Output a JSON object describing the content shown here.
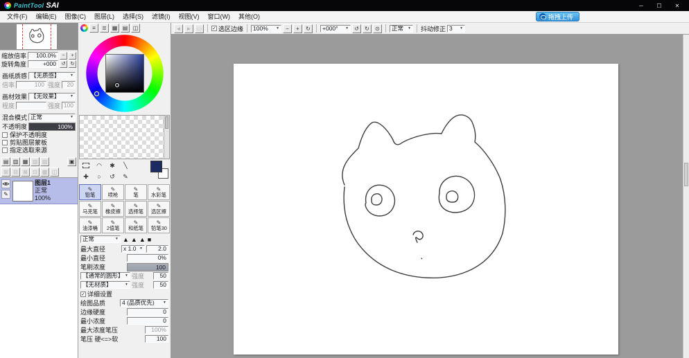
{
  "icons": {
    "minimize": "─",
    "maximize": "☐",
    "close": "✕",
    "dropdown": "▼",
    "check": "✓",
    "zoom_out": "−",
    "zoom_in": "+",
    "reset": "↻",
    "rotate_ccw": "↺",
    "rotate_cw": "↻",
    "rotate_reset": "⊙",
    "nav_back": "◄",
    "nav_fwd": "►",
    "nav_rect": "▭",
    "pen": "✎",
    "lasso": "◠",
    "wand": "✱",
    "move": "✚",
    "magnifier": "○",
    "dropper": "╲",
    "shape_tri": "▲",
    "shape_sq": "■",
    "panel_btn1": "≡",
    "panel_btn2": "≣",
    "panel_btn3": "▦",
    "panel_btn4": "▤",
    "panel_btn5": "◫",
    "layer_btn1": "▤",
    "layer_btn2": "▥",
    "layer_btn3": "▦",
    "layer_btn4": "▧",
    "layer_btn5": "▨",
    "layer_btn6": "⊞",
    "layer_btn7": "⊟",
    "layer_btn8": "⊠",
    "layer_btn9": "⊡",
    "layer_btn10": "▣",
    "layer_btn11": "▩",
    "layer_btn12": "◫"
  },
  "title_bar": {
    "app_name": "PaintTool",
    "app_name_accent": "SAI"
  },
  "menu_bar": {
    "items": [
      "文件(F)",
      "编辑(E)",
      "图像(C)",
      "图层(L)",
      "选择(S)",
      "滤镜(I)",
      "视图(V)",
      "窗口(W)",
      "其他(O)"
    ],
    "upload_label": "拖拽上传"
  },
  "canvas_toolbar": {
    "selection_edge_label": "选区边缘",
    "zoom_value": "100%",
    "angle_value": "+000°",
    "mode_value": "正常",
    "stabilizer_label": "抖动修正",
    "stabilizer_value": "3"
  },
  "navigator": {
    "zoom_label": "缩放倍率",
    "zoom_value": "100.0%",
    "rotate_label": "旋转角度",
    "rotate_value": "+000"
  },
  "paper_panel": {
    "texture_label": "画纸质感",
    "texture_value": "【无质感】",
    "scale_label": "倍率",
    "scale_value": "100",
    "strength_label": "强度",
    "strength_value": "20",
    "effect_label": "画材效果",
    "effect_value": "【无效果】",
    "degree_label": "程度",
    "degree_value": "",
    "strength2_label": "强度",
    "strength2_value": "100"
  },
  "layer_panel": {
    "blend_label": "混合模式",
    "blend_value": "正常",
    "opacity_label": "不透明度",
    "opacity_value": "100%",
    "options": [
      "保护不透明度",
      "剪贴图层蒙板",
      "指定选取来源"
    ],
    "layer_name": "图层1",
    "layer_mode": "正常",
    "layer_opacity": "100%"
  },
  "color_panel": {
    "selected_color": "#1d2b63"
  },
  "tool_panel": {
    "brushes": [
      "铅笔",
      "喷枪",
      "笔",
      "水彩笔",
      "马克笔",
      "橡皮擦",
      "选择笔",
      "选区擦",
      "油漆桶",
      "2值笔",
      "和纸笔",
      "铅笔30"
    ],
    "selected_brush": "铅笔"
  },
  "brush_settings": {
    "mode": "正常",
    "max_diameter_label": "最大直径",
    "max_diameter_unit": "x 1.0",
    "max_diameter_value": "2.0",
    "min_diameter_label": "最小直径",
    "min_diameter_value": "0%",
    "density_label": "笔刷浓度",
    "density_value": "100",
    "shape_label": "【通常的圆形】",
    "shape_strength_label": "强度",
    "shape_strength_value": "50",
    "texture_label": "【无材质】",
    "texture_strength_label": "强度",
    "texture_strength_value": "50",
    "advanced_label": "详细设置",
    "quality_label": "绘图品质",
    "quality_value": "4 (品质优先)",
    "edge_hardness_label": "边缘硬度",
    "edge_hardness_value": "0",
    "min_density_label": "最小浓度",
    "min_density_value": "0",
    "max_density_label": "最大浓度笔压",
    "max_density_value": "100%",
    "pressure_label": "笔压 硬<=>软",
    "pressure_value": "100"
  },
  "canvas": {
    "paths": [
      "M160,175 C150,152 166,136 180,122 C185,104 192,90 200,85 C209,81 222,95 230,110 C232,117 237,119 243,114 C261,104 286,99 300,101 C304,92 312,80 320,76 C330,71 340,76 344,84 C348,93 350,103 348,113 C362,125 377,146 385,167 C393,191 394,220 388,245 C379,273 359,293 329,303 C299,313 259,311 228,298 C200,286 178,264 168,239 C159,219 158,196 160,178",
      "M191,201 C188,184 201,172 216,176 C230,180 237,196 229,210 C221,223 201,223 193,211 C189,205 190,202 191,201",
      "M199,197 C198,189 207,185 212,190 C216,195 214,204 206,204 C200,204 199,201 199,197",
      "M297,187 C296,169 314,158 330,164 C346,170 352,189 344,203 C335,217 311,219 301,207 C295,200 296,192 297,187",
      "M307,193 C306,185 315,181 321,186 C326,191 324,200 316,200 C309,200 307,197 307,193",
      "M259,247 C261,240 271,240 273,247 C274,252 269,256 265,252 C262,249 262,252 265,258",
      "M271,281 l0.6,0.6"
    ]
  }
}
